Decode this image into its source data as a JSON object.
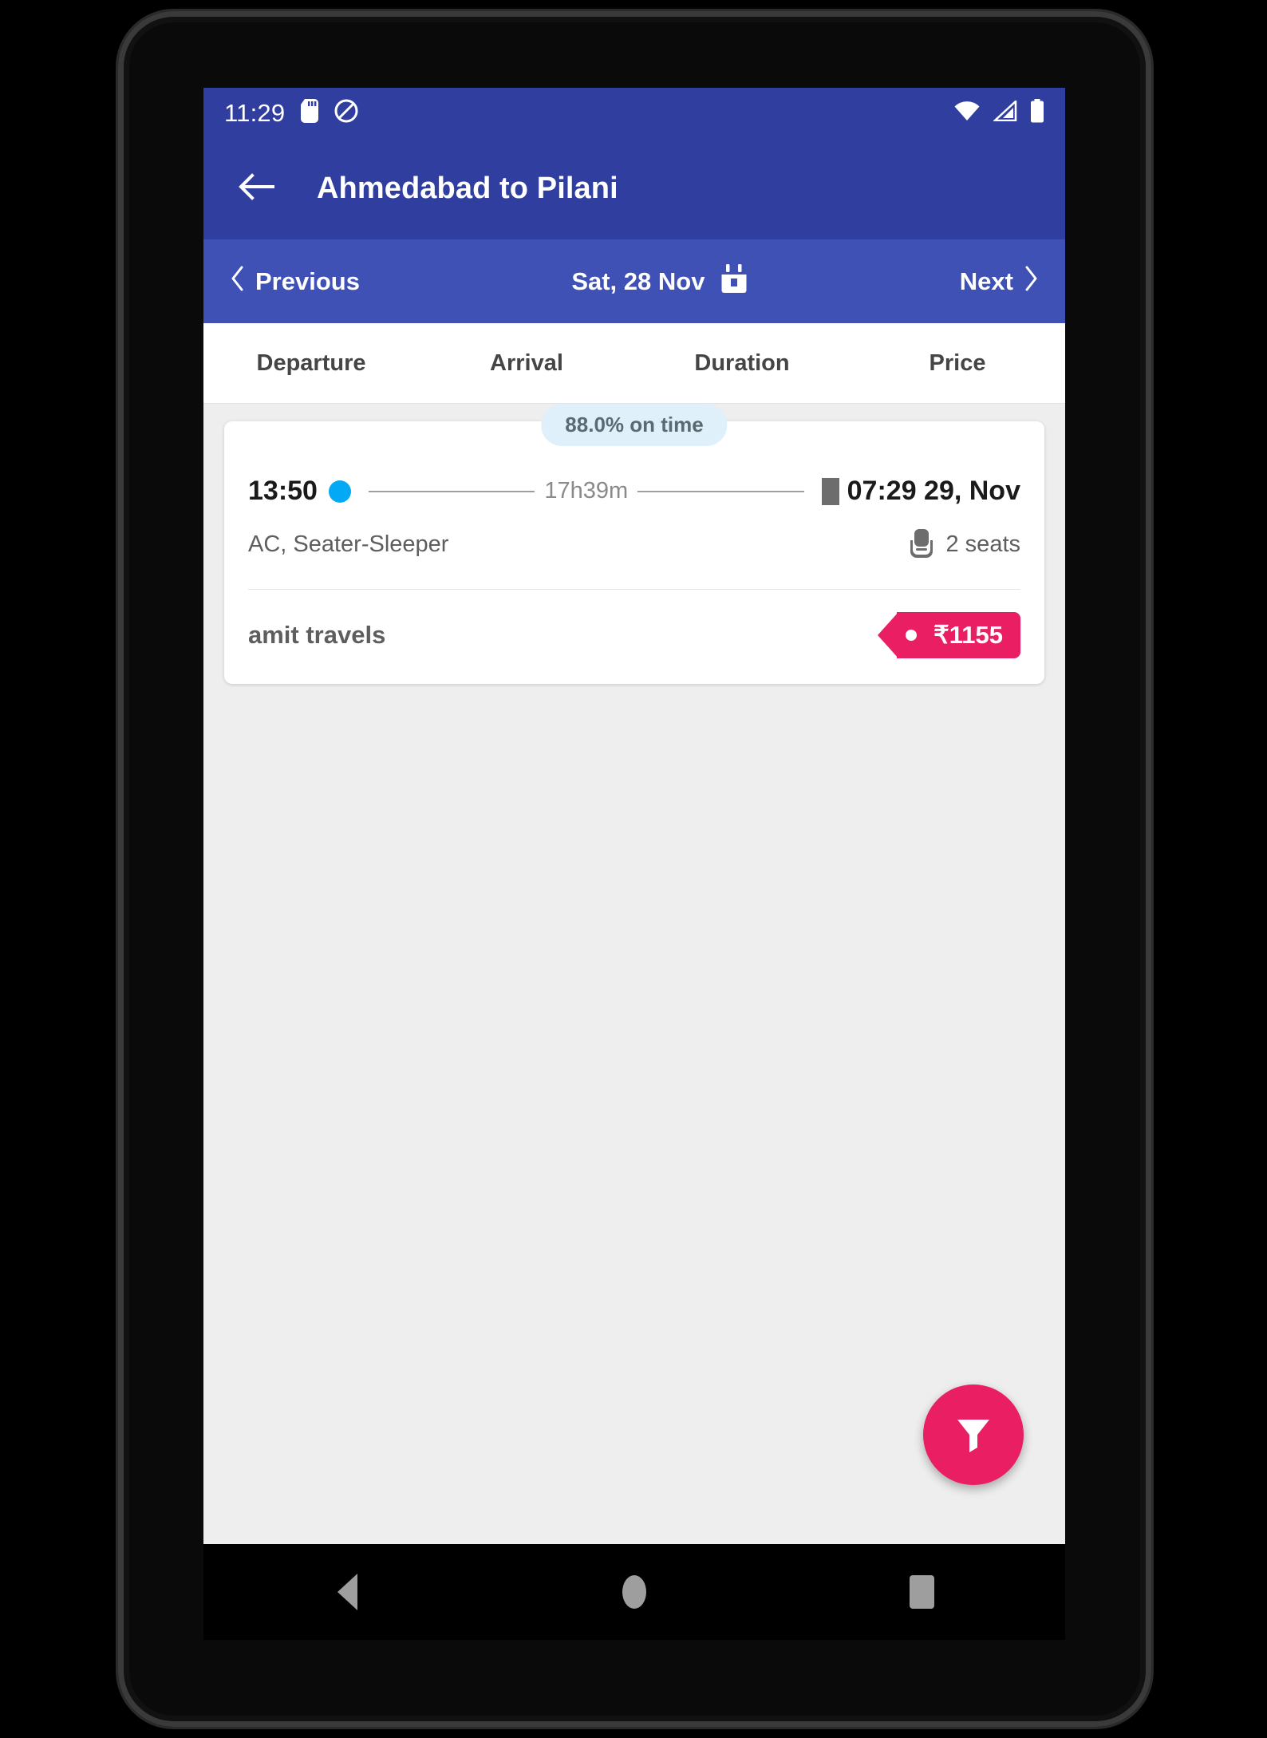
{
  "status_bar": {
    "time": "11:29",
    "icons_left": [
      "sd-card-icon",
      "do-not-disturb-icon"
    ],
    "icons_right": [
      "wifi-icon",
      "cell-signal-icon",
      "battery-icon"
    ]
  },
  "app_bar": {
    "back_icon": "back-arrow-icon",
    "title": "Ahmedabad to Pilani"
  },
  "date_nav": {
    "previous_label": "Previous",
    "previous_icon": "chevron-left-icon",
    "date_label": "Sat, 28 Nov",
    "calendar_icon": "calendar-icon",
    "next_label": "Next",
    "next_icon": "chevron-right-icon"
  },
  "sort_tabs": [
    {
      "label": "Departure"
    },
    {
      "label": "Arrival"
    },
    {
      "label": "Duration"
    },
    {
      "label": "Price"
    }
  ],
  "results": [
    {
      "ontime_badge": "88.0% on time",
      "departure_time": "13:50",
      "duration": "17h39m",
      "arrival_time": "07:29 29, Nov",
      "bus_type": "AC, Seater-Sleeper",
      "seats": "2 seats",
      "seat_icon": "bus-seat-icon",
      "operator": "amit travels",
      "price": "₹1155"
    }
  ],
  "fab": {
    "icon": "filter-funnel-icon",
    "name": "filter"
  },
  "nav_bar": {
    "back": "back-triangle-icon",
    "home": "home-circle-icon",
    "recents": "recents-square-icon"
  },
  "colors": {
    "primary_dark": "#303f9f",
    "primary": "#3f51b5",
    "accent": "#e91e63",
    "departure_dot": "#03a9f4",
    "badge_bg": "#dff0fb",
    "page_bg": "#eeeeee"
  }
}
